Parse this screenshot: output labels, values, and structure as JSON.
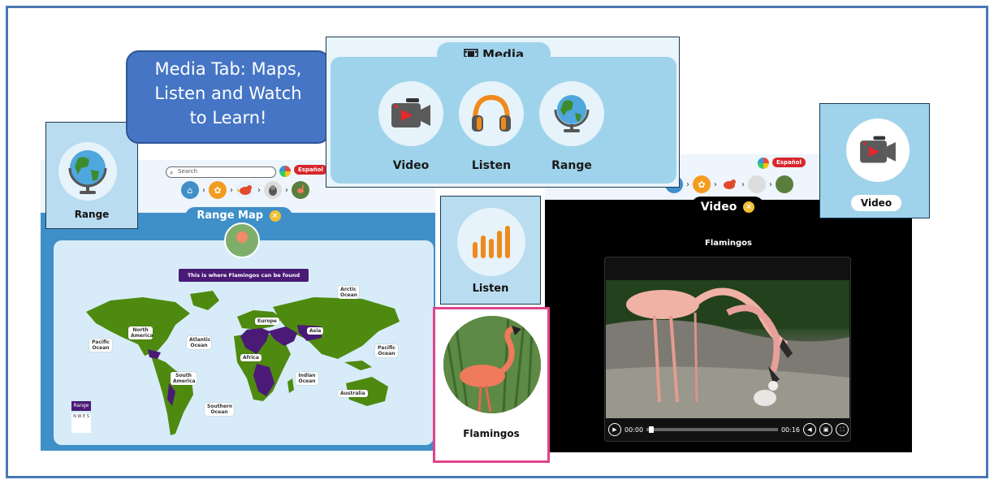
{
  "callout": {
    "line1": "Media Tab: Maps,",
    "line2": "Listen and Watch",
    "line3": "to Learn!"
  },
  "range_map": {
    "search_placeholder": "Search",
    "lang_button": "Español",
    "tab_title": "Range Map",
    "close_symbol": "×",
    "banner": "This is where Flamingos can be found",
    "labels": {
      "arctic": "Arctic Ocean",
      "north_america": "North America",
      "europe": "Europe",
      "asia": "Asia",
      "pacific_left": "Pacific Ocean",
      "atlantic": "Atlantic Ocean",
      "africa": "Africa",
      "pacific_right": "Pacific Ocean",
      "south_america": "South America",
      "indian": "Indian Ocean",
      "southern": "Southern Ocean",
      "australia": "Australia"
    },
    "legend": "Range",
    "compass": "N W E S"
  },
  "range_tile": {
    "label": "Range"
  },
  "media_panel": {
    "tab_title": "Media",
    "items": [
      {
        "label": "Video",
        "icon": "video-camera-icon"
      },
      {
        "label": "Listen",
        "icon": "headphones-icon"
      },
      {
        "label": "Range",
        "icon": "globe-icon"
      }
    ]
  },
  "listen_tile": {
    "label": "Listen",
    "icon": "audio-bars-icon"
  },
  "flamingo_card": {
    "label": "Flamingos"
  },
  "video_panel": {
    "lang_button": "Español",
    "tab_title": "Video",
    "close_symbol": "×",
    "title": "Flamingos",
    "time_current": "00:00",
    "time_total": "00:16",
    "progress": 0.02
  },
  "video_tile": {
    "label": "Video",
    "icon": "video-camera-icon"
  },
  "colors": {
    "frame_border": "#4a77b3",
    "callout": "#4575c4",
    "media_blue": "#9fd3ec",
    "range_purple": "#4a1a76",
    "land_green": "#4f8a10",
    "card_pink": "#e0448c",
    "accent_orange": "#f08a1c",
    "lang_red": "#d8262c"
  }
}
